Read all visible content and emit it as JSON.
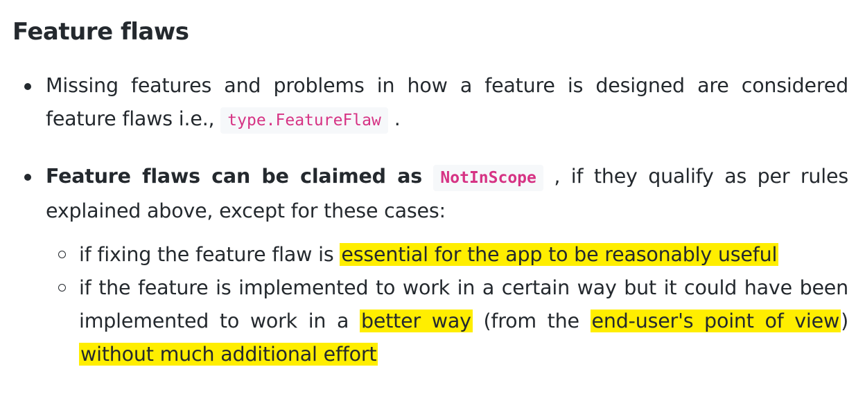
{
  "heading": "Feature flaws",
  "items": [
    {
      "text_before": "Missing features and problems in how a feature is designed are considered feature flaws i.e., ",
      "code": "type.FeatureFlaw",
      "text_after": " ."
    },
    {
      "bold": "Feature flaws can be claimed as ",
      "code": "NotInScope",
      "text_after": " , if they qualify as per rules explained above, except for these cases:",
      "subitems": [
        {
          "text_before": "if fixing the feature flaw is ",
          "highlight": "essential for the app to be reasonably useful"
        },
        {
          "text_1": "if the feature is implemented to work in a certain way but it could have been implemented to work in a ",
          "highlight_1": "better way",
          "text_2": " (from the ",
          "highlight_2": "end-user's point of view",
          "text_3": ") ",
          "highlight_3": "without much additional effort"
        }
      ]
    }
  ],
  "colors": {
    "highlight": "#ffee00",
    "code_text": "#d63384",
    "code_bg": "#f6f8fa",
    "text": "#24292e"
  }
}
